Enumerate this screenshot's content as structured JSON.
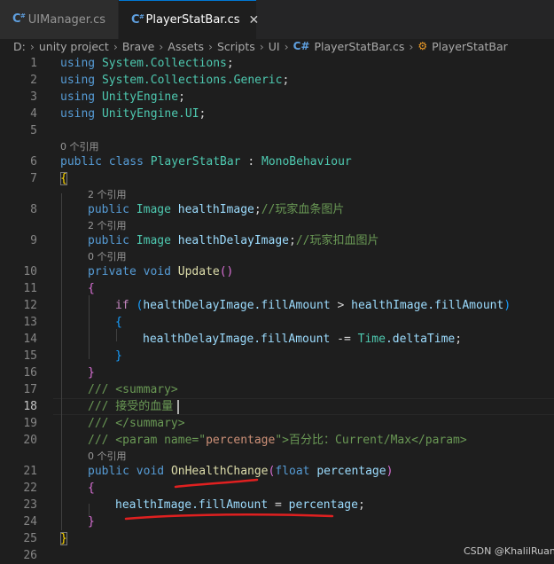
{
  "tabs": [
    {
      "label": "UIManager.cs",
      "icon": "csharp-file-icon",
      "active": false
    },
    {
      "label": "PlayerStatBar.cs",
      "icon": "csharp-file-icon",
      "active": true,
      "close": "✕"
    }
  ],
  "breadcrumb": {
    "parts": [
      "D:",
      "unity project",
      "Brave",
      "Assets",
      "Scripts",
      "UI",
      "PlayerStatBar.cs",
      "PlayerStatBar"
    ],
    "separator": "›"
  },
  "lens": {
    "refs0": "0 个引用",
    "refs2": "2 个引用"
  },
  "lines": {
    "l1": {
      "kw": "using",
      "ns": "System.Collections",
      "end": ";"
    },
    "l2": {
      "kw": "using",
      "ns": "System.Collections.Generic",
      "end": ";"
    },
    "l3": {
      "kw": "using",
      "ns": "UnityEngine",
      "end": ";"
    },
    "l4": {
      "kw": "using",
      "ns": "UnityEngine.UI",
      "end": ";"
    },
    "l6": {
      "kw1": "public",
      "kw2": "class",
      "name": "PlayerStatBar",
      "colon": " : ",
      "base": "MonoBehaviour"
    },
    "l7": {
      "brace": "{"
    },
    "l8": {
      "kw": "public",
      "type": "Image",
      "name": "healthImage",
      "end": ";",
      "comment": "//玩家血条图片"
    },
    "l9": {
      "kw": "public",
      "type": "Image",
      "name": "healthDelayImage",
      "end": ";",
      "comment": "//玩家扣血图片"
    },
    "l10": {
      "kw1": "private",
      "kw2": "void",
      "fn": "Update",
      "parens": "()"
    },
    "l11": {
      "brace": "{"
    },
    "l12": {
      "kw": "if",
      "open": "(",
      "a": "healthDelayImage",
      "ap": ".fillAmount",
      "op": " > ",
      "b": "healthImage",
      "bp": ".fillAmount",
      "close": ")"
    },
    "l13": {
      "brace": "{"
    },
    "l14": {
      "a": "healthDelayImage",
      "ap": ".fillAmount",
      "op": " -= ",
      "t": "Time",
      "tp": ".deltaTime",
      "end": ";"
    },
    "l15": {
      "brace": "}"
    },
    "l16": {
      "brace": "}"
    },
    "l17": {
      "text": "/// <summary>"
    },
    "l18": {
      "text": "/// 接受的血量"
    },
    "l19": {
      "text": "/// </summary>"
    },
    "l20": {
      "pre": "/// <param name=\"",
      "attr": "percentage",
      "post": "\">百分比：Current/Max</param>"
    },
    "l21": {
      "kw1": "public",
      "kw2": "void",
      "fn": "OnHealthChange",
      "open": "(",
      "ptype": "float",
      "pname": "percentage",
      "close": ")"
    },
    "l22": {
      "brace": "{"
    },
    "l23": {
      "a": "healthImage",
      "ap": ".fillAmount",
      "op": " = ",
      "b": "percentage",
      "end": ";"
    },
    "l24": {
      "brace": "}"
    },
    "l25": {
      "brace": "}"
    }
  },
  "line_numbers": [
    "1",
    "2",
    "3",
    "4",
    "5",
    "6",
    "7",
    "8",
    "9",
    "10",
    "11",
    "12",
    "13",
    "14",
    "15",
    "16",
    "17",
    "18",
    "19",
    "20",
    "21",
    "22",
    "23",
    "24",
    "25",
    "26"
  ],
  "watermark": "CSDN @KhalilRuan",
  "colors": {
    "keyword": "#569cd6",
    "control": "#c586c0",
    "type": "#4ec9b0",
    "function": "#dcdcaa",
    "variable": "#9cdcfe",
    "string": "#ce9178",
    "comment": "#6a9955",
    "annotation": "#e02020"
  }
}
